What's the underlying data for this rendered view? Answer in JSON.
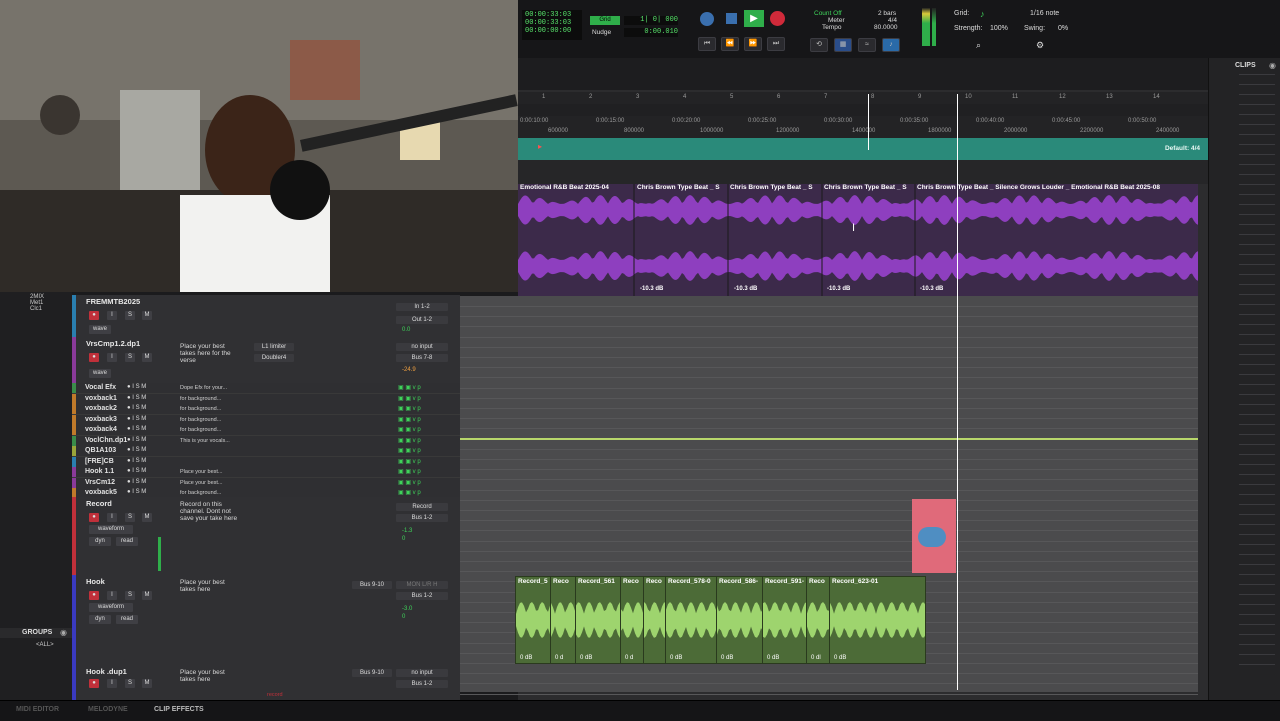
{
  "transport": {
    "counter_main": "00:00:33:03",
    "counter_start": "00:00:33:03",
    "counter_end": "00:00:00:00",
    "grid_label": "Grid",
    "grid_value": "1| 0| 000",
    "nudge_label": "Nudge",
    "nudge_value": "0:00.010",
    "count_off": "Count Off",
    "meter_label": "Meter",
    "meter_value": "4/4",
    "tempo_label": "Tempo",
    "tempo_value": "80.0000",
    "bars_value": "2 bars"
  },
  "grid_panel": {
    "grid_label": "Grid:",
    "grid_value": "1/16 note",
    "strength_label": "Strength:",
    "strength_value": "100%",
    "swing_label": "Swing:",
    "swing_value": "0%"
  },
  "ruler": {
    "bars": [
      "1",
      "2",
      "3",
      "4",
      "5",
      "6",
      "7",
      "8",
      "9",
      "10",
      "11",
      "12",
      "13",
      "14"
    ],
    "minsecs": [
      "0:00:10:00",
      "0:00:15:00",
      "0:00:20:00",
      "0:00:25:00",
      "0:00:30:00",
      "0:00:35:00",
      "0:00:40:00",
      "0:00:45:00",
      "0:00:50:00"
    ],
    "samples": [
      "600000",
      "800000",
      "1000000",
      "1200000",
      "1400000",
      "1800000",
      "2000000",
      "2200000",
      "2400000"
    ],
    "meter_label": "Default: 4/4"
  },
  "beat_clips": [
    {
      "name": "Emotional R&B Beat 2025-04",
      "db": ""
    },
    {
      "name": "Chris Brown Type Beat _ S",
      "db": "-10.3 dB"
    },
    {
      "name": "Chris Brown Type Beat _ S",
      "db": "-10.3 dB"
    },
    {
      "name": "Chris Brown Type Beat _ S",
      "db": "-10.3 dB"
    },
    {
      "name": "Chris Brown Type Beat _ Silence Grows Louder _ Emotional R&B Beat 2025-08",
      "db": "-10.3 dB"
    }
  ],
  "left_panel": {
    "items": [
      "2MIX",
      "Met1",
      "Clc1"
    ],
    "groups_title": "GROUPS",
    "groups_all": "<ALL>"
  },
  "tracks": {
    "fremm": {
      "name": "FREMMTB2025",
      "io_in": "In 1-2",
      "io_out": "Out 1-2",
      "vol": "0.0",
      "view": "wave"
    },
    "vrs": {
      "name": "VrsCmp1.2.dp1",
      "comment": "Place your best takes here for the verse",
      "insert1": "L1 limiter",
      "insert2": "Doubler4",
      "io_in": "no input",
      "io_out": "Bus 7-8",
      "vol": "-24.9",
      "view": "wave"
    },
    "small": [
      {
        "name": "Vocal Efx",
        "comment": "Dope Efx for your...",
        "color": "#3a8c4a"
      },
      {
        "name": "voxback1",
        "comment": "for background...",
        "color": "#c07a2a"
      },
      {
        "name": "voxback2",
        "comment": "for background...",
        "color": "#c07a2a"
      },
      {
        "name": "voxback3",
        "comment": "for background...",
        "color": "#c07a2a"
      },
      {
        "name": "voxback4",
        "comment": "for background...",
        "color": "#c07a2a"
      },
      {
        "name": "VoclChn.dp1",
        "comment": "This is your vocals...",
        "color": "#3a8c4a"
      },
      {
        "name": "QB1A103",
        "comment": "",
        "color": "#9aa53a"
      },
      {
        "name": "[FRE]CB",
        "comment": "",
        "color": "#2a7fb0"
      },
      {
        "name": "Hook 1.1",
        "comment": "Place your best...",
        "color": "#8a3a9a"
      },
      {
        "name": "VrsCm12",
        "comment": "Place your best...",
        "color": "#8a3a9a"
      },
      {
        "name": "voxback5",
        "comment": "for background...",
        "color": "#c07a2a"
      }
    ],
    "record": {
      "name": "Record",
      "comment": "Record on this channel. Dont not save your take here",
      "io_in": "Record",
      "io_out": "Bus 1-2",
      "vol": "-1.3",
      "pan": "0",
      "view": "waveform",
      "dyn": "dyn",
      "read": "read"
    },
    "hook": {
      "name": "Hook",
      "comment": "Place your best takes here",
      "io_in": "Bus 9-10",
      "io_out": "Bus 1-2",
      "insert": "MON L/R H",
      "vol": "-3.0",
      "pan": "0",
      "view": "waveform",
      "dyn": "dyn",
      "read": "read"
    },
    "hookdup": {
      "name": "Hook .dup1",
      "comment": "Place your best takes here",
      "io_in": "no input",
      "io_out": "Bus 1-2",
      "bus": "Bus 9-10",
      "record_tag": "record"
    }
  },
  "record_clips": [
    {
      "name": "Record_5",
      "db": "0 dB"
    },
    {
      "name": "Reco",
      "db": "0 d"
    },
    {
      "name": "Record_561",
      "db": "0 dB"
    },
    {
      "name": "Reco",
      "db": "0 d"
    },
    {
      "name": "Reco",
      "db": ""
    },
    {
      "name": "Record_578-0",
      "db": "0 dB"
    },
    {
      "name": "Record_586-",
      "db": "0 dB"
    },
    {
      "name": "Record_591-",
      "db": "0 dB"
    },
    {
      "name": "Reco",
      "db": "0 dl"
    },
    {
      "name": "Record_623-01",
      "db": "0 dB"
    }
  ],
  "clips_panel": {
    "title": "CLIPS"
  },
  "bottom_tabs": {
    "midi": "MIDI EDITOR",
    "melodyne": "MELODYNE",
    "clip_effects": "CLIP EFFECTS"
  },
  "colors": {
    "beat_clip": "#8e3fbf",
    "record_clip": "#4c6b37",
    "marker_bar": "#2a8a7a",
    "playhead": "#ffffff",
    "selection_clip": "#e06a7a",
    "green_line": "#b7d66b"
  }
}
